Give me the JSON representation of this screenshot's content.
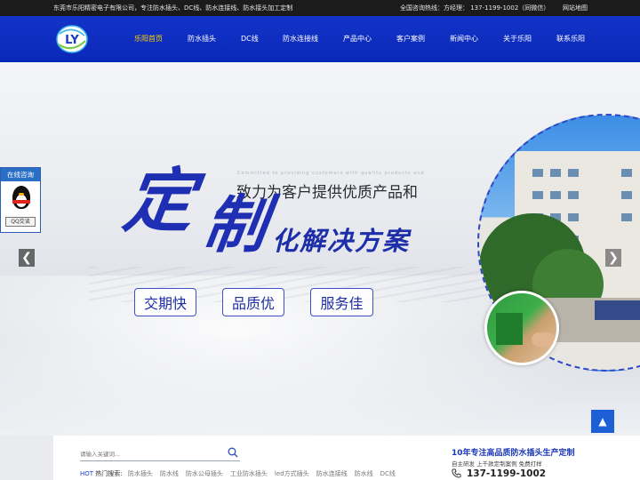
{
  "topbar": {
    "company_intro": "东莞市乐阳精密电子有限公司，专注防水插头、DC线、防水连接线、防水接头加工定制",
    "hotline": "全国咨询热线：方经理： 137-1199-1002（同微信）",
    "sitemap": "网站地图"
  },
  "logo": {
    "text": "LY"
  },
  "nav": {
    "items": [
      {
        "label": "乐阳首页"
      },
      {
        "label": "防水插头"
      },
      {
        "label": "DC线"
      },
      {
        "label": "防水连接线"
      },
      {
        "label": "产品中心"
      },
      {
        "label": "客户案例"
      },
      {
        "label": "新闻中心"
      },
      {
        "label": "关于乐阳"
      },
      {
        "label": "联系乐阳"
      }
    ],
    "active_color": "#ffd300"
  },
  "hero": {
    "tagline_en": "Committed to providing customers with quality products and",
    "tagline": "致力为客户提供优质产品和",
    "big_char_1": "定",
    "big_char_2": "制",
    "slogan": "化解决方案",
    "features": [
      "交期快",
      "品质优",
      "服务佳"
    ],
    "accent_color": "#1f2fb3"
  },
  "consult": {
    "title": "在线咨询",
    "qq_button": "QQ交谈"
  },
  "controls": {
    "prev": "❮",
    "next": "❯",
    "back_to_top": "▲"
  },
  "search": {
    "placeholder": "请输入关键词...",
    "hot_label": "HOT",
    "hot_suffix": "热门搜索:",
    "keywords": [
      "防水插头",
      "防水线",
      "防水公母插头",
      "工业防水插头",
      "led方式插头",
      "防水连接线",
      "防水线",
      "DC线"
    ]
  },
  "promo": {
    "title": "10年专注高品质防水插头生产定制",
    "subtitle": "自主研发 上千款定制案例 免费打样",
    "phone": "137-1199-1002"
  }
}
